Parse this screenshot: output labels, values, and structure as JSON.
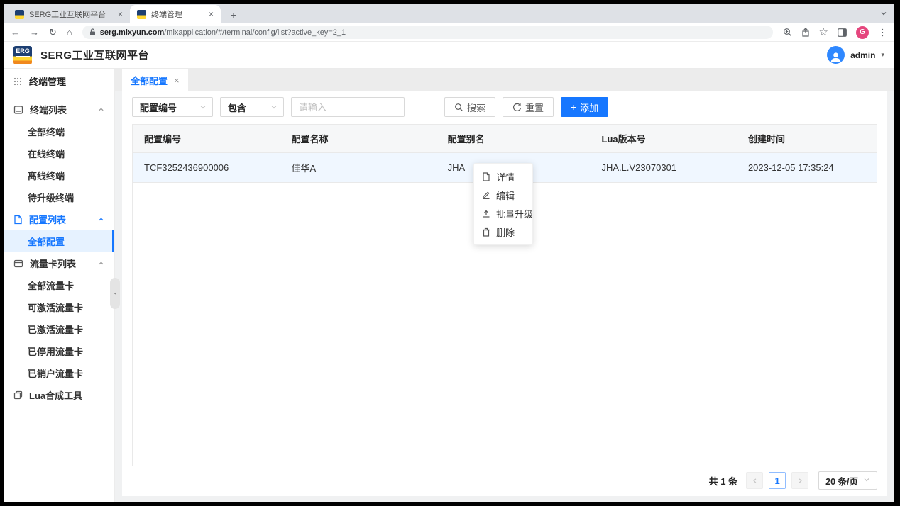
{
  "browser": {
    "tab1_title": "SERG工业互联网平台",
    "tab2_title": "终端管理",
    "url_domain": "serg.mixyun.com",
    "url_path": "/mixapplication/#/terminal/config/list?active_key=2_1",
    "profile_initial": "G"
  },
  "icons": {
    "close": "×",
    "back": "←",
    "forward": "→",
    "reload": "↻",
    "home": "⌂",
    "star": "☆",
    "more": "⋮",
    "plus": "+",
    "caret": "▾",
    "collapse": "◂"
  },
  "header": {
    "logo_text": "ERG",
    "brand": "SERG工业互联网平台",
    "user": "admin"
  },
  "sidebar": {
    "title": "终端管理",
    "groups": [
      {
        "label": "终端列表",
        "items": [
          "全部终端",
          "在线终端",
          "离线终端",
          "待升级终端"
        ]
      },
      {
        "label": "配置列表",
        "items": [
          "全部配置"
        ]
      },
      {
        "label": "流量卡列表",
        "items": [
          "全部流量卡",
          "可激活流量卡",
          "已激活流量卡",
          "已停用流量卡",
          "已销户流量卡"
        ]
      }
    ],
    "tool": "Lua合成工具",
    "active_item": "全部配置"
  },
  "content": {
    "tab_label": "全部配置",
    "filter": {
      "field_select": "配置编号",
      "operator_select": "包含",
      "input_placeholder": "请输入",
      "search_label": "搜索",
      "reset_label": "重置",
      "add_label": "添加"
    },
    "table": {
      "columns": [
        "配置编号",
        "配置名称",
        "配置别名",
        "Lua版本号",
        "创建时间"
      ],
      "rows": [
        [
          "TCF3252436900006",
          "佳华A",
          "JHA",
          "JHA.L.V23070301",
          "2023-12-05 17:35:24"
        ]
      ]
    },
    "context_menu": {
      "items": [
        "详情",
        "编辑",
        "批量升级",
        "删除"
      ]
    },
    "pagination": {
      "total": "共 1 条",
      "current_page": "1",
      "page_size": "20 条/页"
    }
  },
  "colors": {
    "accent": "#1677ff",
    "row_highlight": "#f0f7ff",
    "active_menu_bg": "#e6f2ff",
    "profile_badge": "#e5467e"
  }
}
